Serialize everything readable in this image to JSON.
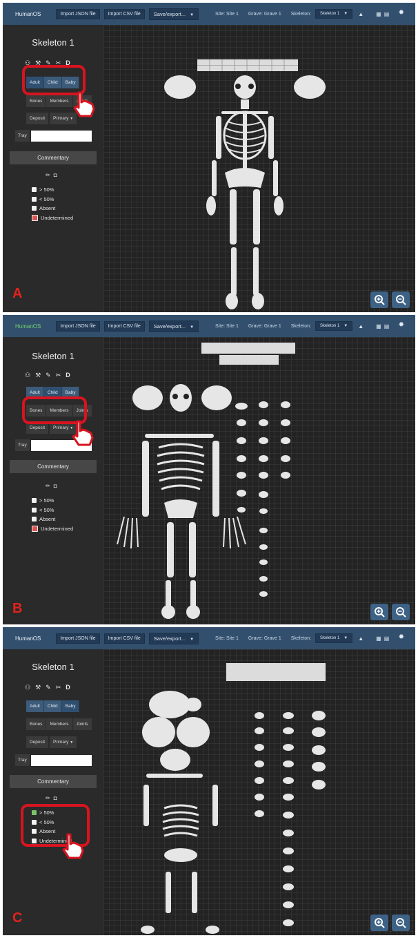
{
  "app": {
    "brand": "HumanOS",
    "import_json": "Import JSON file",
    "import_csv": "Import CSV file",
    "save_export": "Save/export...",
    "site": "Site: Site 1",
    "grave": "Grave: Grave 1",
    "skeleton_label": "Skeleton:",
    "skeleton_value": "Skeleton 1"
  },
  "sidebar": {
    "title": "Skeleton 1",
    "age_tabs": [
      "Adult",
      "Child",
      "Baby"
    ],
    "view_tabs": [
      "Bones",
      "Members",
      "Joints"
    ],
    "deposit_label": "Deposit",
    "deposit_value": "Primary",
    "tray_label": "Tray",
    "commentary": "Commentary",
    "legend": [
      "> 50%",
      "< 50%",
      "Absent",
      "Undetermined"
    ],
    "tool_d": "D"
  },
  "panels": [
    {
      "letter": "A",
      "age": "Adult",
      "selected_legend": "Undetermined",
      "brand_accent": "#ffffff"
    },
    {
      "letter": "B",
      "age": "Child",
      "selected_legend": "Undetermined",
      "brand_accent": "#6fcf6a"
    },
    {
      "letter": "C",
      "age": "Baby",
      "selected_legend": "> 50%",
      "brand_accent": "#ffffff"
    }
  ],
  "colors": {
    "topbar": "#32506e",
    "highlight": "#d7141f",
    "tab_blue": "#3d5b7a",
    "canvas": "#232323"
  },
  "icons": [
    "gear-icon",
    "trash-icon",
    "zoom-in-icon",
    "zoom-out-icon",
    "pencil-icon",
    "camera-icon",
    "hand-pointer-icon"
  ]
}
